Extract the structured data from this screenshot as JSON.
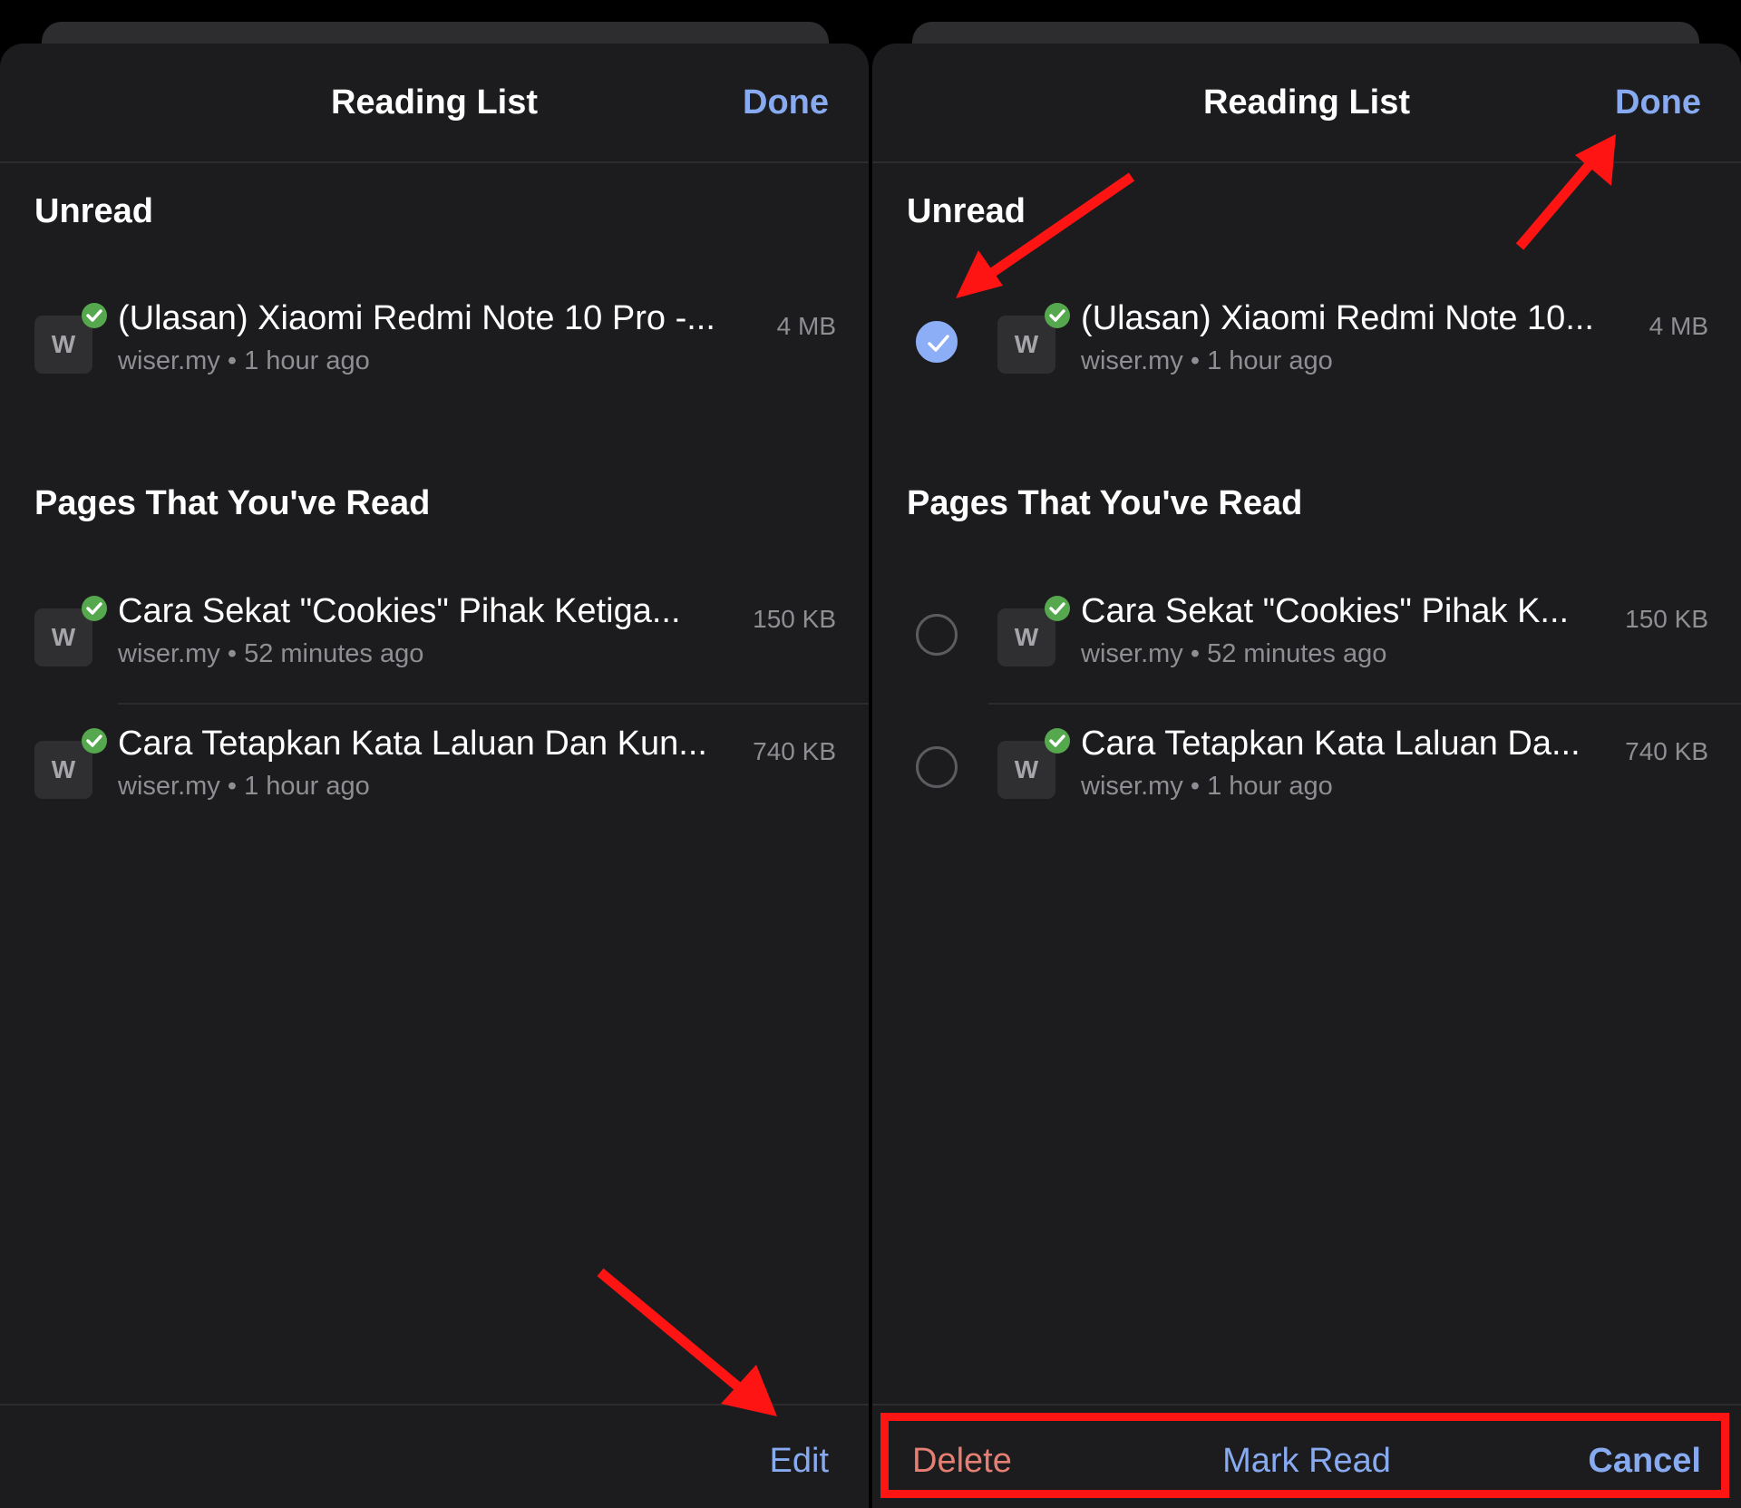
{
  "colors": {
    "accent": "#87aaf0",
    "destructive": "#e57f74",
    "read_badge": "#56a84f",
    "annotation": "#ff1414"
  },
  "left": {
    "title": "Reading List",
    "done": "Done",
    "sections": [
      {
        "title": "Unread",
        "items": [
          {
            "favicon": "W",
            "title": "(Ulasan) Xiaomi Redmi Note 10 Pro -...",
            "site": "wiser.my",
            "time": "1 hour ago",
            "size": "4 MB"
          }
        ]
      },
      {
        "title": "Pages That You've Read",
        "items": [
          {
            "favicon": "W",
            "title": "Cara Sekat \"Cookies\" Pihak Ketiga...",
            "site": "wiser.my",
            "time": "52 minutes ago",
            "size": "150 KB"
          },
          {
            "favicon": "W",
            "title": "Cara Tetapkan Kata Laluan Dan Kun...",
            "site": "wiser.my",
            "time": "1 hour ago",
            "size": "740 KB"
          }
        ]
      }
    ],
    "toolbar": {
      "edit": "Edit"
    }
  },
  "right": {
    "title": "Reading List",
    "done": "Done",
    "sections": [
      {
        "title": "Unread",
        "items": [
          {
            "favicon": "W",
            "title": "(Ulasan) Xiaomi Redmi Note 10...",
            "site": "wiser.my",
            "time": "1 hour ago",
            "size": "4 MB",
            "selected": true
          }
        ]
      },
      {
        "title": "Pages That You've Read",
        "items": [
          {
            "favicon": "W",
            "title": "Cara Sekat \"Cookies\" Pihak K...",
            "site": "wiser.my",
            "time": "52 minutes ago",
            "size": "150 KB",
            "selected": false
          },
          {
            "favicon": "W",
            "title": "Cara Tetapkan Kata Laluan Da...",
            "site": "wiser.my",
            "time": "1 hour ago",
            "size": "740 KB",
            "selected": false
          }
        ]
      }
    ],
    "toolbar": {
      "delete": "Delete",
      "mark_read": "Mark Read",
      "cancel": "Cancel"
    }
  },
  "separator": "•"
}
